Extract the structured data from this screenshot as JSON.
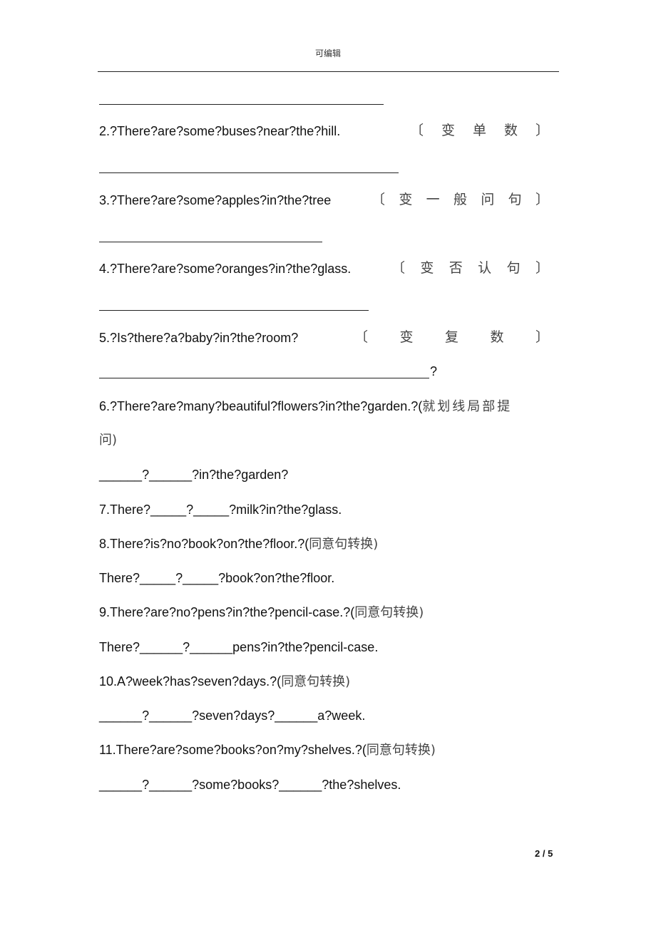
{
  "header": {
    "title": "可编辑"
  },
  "exercises": {
    "q2": {
      "text": "2.?There?are?some?buses?near?the?hill.",
      "hint": [
        "〔",
        "变",
        "单",
        "数",
        "〕"
      ]
    },
    "q3": {
      "text": "3.?There?are?some?apples?in?the?tree",
      "hint": [
        "〔",
        "变",
        "一",
        "般",
        "问",
        "句",
        "〕"
      ]
    },
    "q4": {
      "text": "4.?There?are?some?oranges?in?the?glass.",
      "hint": [
        "〔",
        "变",
        "否",
        "认",
        "句",
        "〕"
      ]
    },
    "q5": {
      "text": "5.?Is?there?a?baby?in?the?room?",
      "hint": [
        "〔",
        "变",
        "复",
        "数",
        "〕"
      ],
      "answer_suffix": "?"
    },
    "q6": {
      "text": "6.?There?are?many?beautiful?flowers?in?the?garden.?(",
      "instruction_line1": "就划线局部提",
      "instruction_line2": "问)",
      "answer": "______?______?in?the?garden?"
    },
    "q7": {
      "text": "7.There?_____?_____?milk?in?the?glass."
    },
    "q8": {
      "text": "8.There?is?no?book?on?the?floor.?(",
      "instruction": "同意句转换)",
      "answer": "There?_____?_____?book?on?the?floor."
    },
    "q9": {
      "text": "9.There?are?no?pens?in?the?pencil-case.?(",
      "instruction": "同意句转换)",
      "answer": "There?______?______pens?in?the?pencil-case."
    },
    "q10": {
      "text": "10.A?week?has?seven?days.?(",
      "instruction": "同意句转换)",
      "answer": "______?______?seven?days?______a?week."
    },
    "q11": {
      "text": "11.There?are?some?books?on?my?shelves.?(",
      "instruction": "同意句转换)",
      "answer": "______?______?some?books?______?the?shelves."
    }
  },
  "footer": {
    "page_number": "2 / 5"
  }
}
